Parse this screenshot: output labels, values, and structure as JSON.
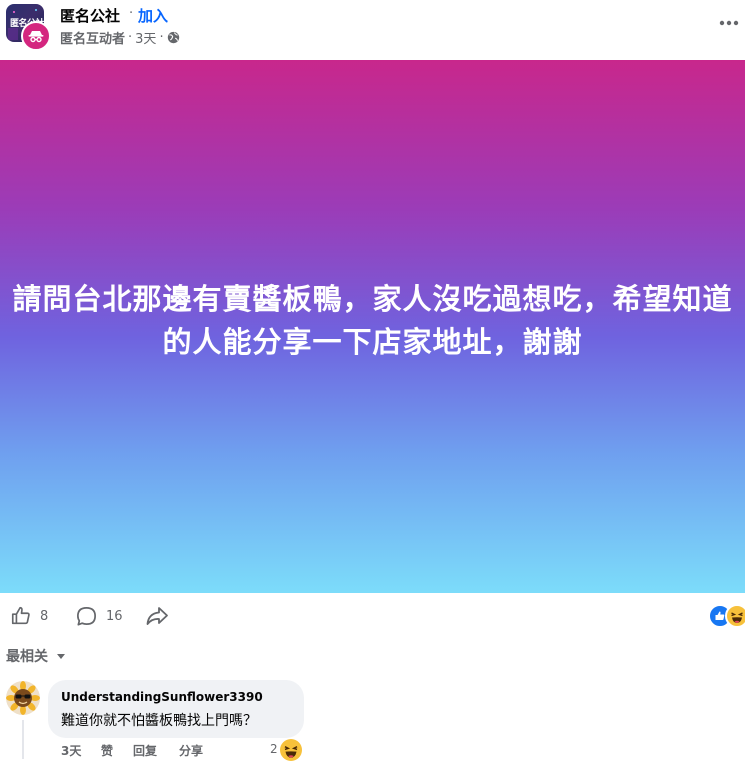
{
  "header": {
    "group_avatar_text": "匿名公社",
    "group_name": "匿名公社",
    "separator": "·",
    "join_label": "加入",
    "author": "匿名互动者",
    "time": "3天",
    "audience_icon": "globe-icon",
    "more_icon": "more-horizontal-icon"
  },
  "post": {
    "text": "請問台北那邊有賣醬板鴨，家人沒吃過想吃，希望知道的人能分享一下店家地址，謝謝",
    "gradient_colors": [
      "#c8278c",
      "#6f63df",
      "#7cdcfa"
    ]
  },
  "actions": {
    "like_icon": "thumbs-up-icon",
    "like_count": "8",
    "comment_icon": "comment-icon",
    "comment_count": "16",
    "share_icon": "share-icon",
    "reaction_icons": [
      "like-reaction-icon",
      "haha-reaction-icon"
    ]
  },
  "sort": {
    "label": "最相关",
    "icon": "caret-down-icon"
  },
  "comment": {
    "author": "UnderstandingSunflower3390",
    "text": "難道你就不怕醬板鴨找上門嗎？",
    "time": "3天",
    "like_label": "赞",
    "reply_label": "回复",
    "share_label": "分享",
    "reaction_count": "2",
    "reaction_icon": "haha-reaction-icon"
  },
  "colors": {
    "accent": "#0866ff",
    "muted_text": "#65676b",
    "bubble": "#f0f2f5",
    "anon_badge": "#d4267f"
  }
}
